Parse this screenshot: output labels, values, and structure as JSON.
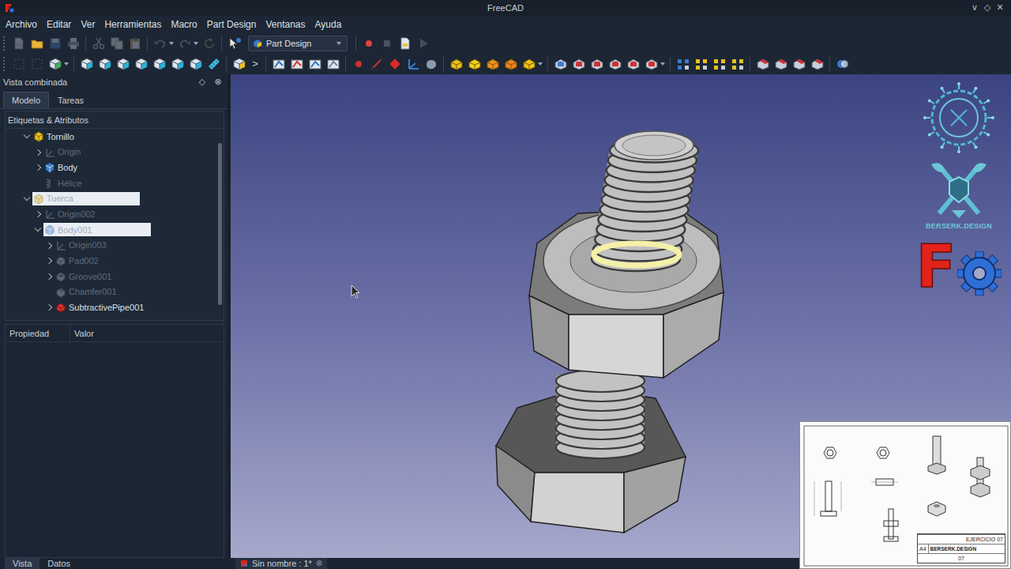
{
  "window": {
    "title": "FreeCAD",
    "controls": [
      "∨",
      "◇",
      "✕"
    ]
  },
  "menu": [
    "Archivo",
    "Editar",
    "Ver",
    "Herramientas",
    "Macro",
    "Part Design",
    "Ventanas",
    "Ayuda"
  ],
  "toolbars": [
    {
      "items": [
        {
          "kind": "button",
          "disabled": true
        },
        {
          "kind": "button",
          "disabled": false
        },
        {
          "kind": "button",
          "disabled": true
        },
        {
          "kind": "button",
          "disabled": true
        },
        {
          "kind": "separator"
        },
        {
          "kind": "button",
          "disabled": true
        },
        {
          "kind": "button",
          "disabled": true
        },
        {
          "kind": "button",
          "disabled": true
        },
        {
          "kind": "separator"
        },
        {
          "kind": "split",
          "disabled": true
        },
        {
          "kind": "split",
          "disabled": true
        },
        {
          "kind": "button",
          "disabled": true
        },
        {
          "kind": "separator"
        },
        {
          "kind": "button",
          "disabled": false
        },
        {
          "kind": "combo",
          "label": "Part Design"
        },
        {
          "kind": "separator"
        },
        {
          "kind": "button",
          "disabled": false
        },
        {
          "kind": "button",
          "disabled": true
        },
        {
          "kind": "button",
          "disabled": false
        },
        {
          "kind": "button",
          "disabled": true
        }
      ]
    },
    {
      "items": [
        {
          "kind": "button",
          "disabled": true
        },
        {
          "kind": "button",
          "disabled": true
        },
        {
          "kind": "split",
          "disabled": false
        },
        {
          "kind": "separator"
        },
        {
          "kind": "button",
          "disabled": false
        },
        {
          "kind": "button",
          "disabled": false
        },
        {
          "kind": "button",
          "disabled": false
        },
        {
          "kind": "button",
          "disabled": false
        },
        {
          "kind": "button",
          "disabled": false
        },
        {
          "kind": "button",
          "disabled": false
        },
        {
          "kind": "button",
          "disabled": false
        },
        {
          "kind": "button",
          "disabled": false
        },
        {
          "kind": "separator"
        },
        {
          "kind": "button",
          "disabled": false
        },
        {
          "kind": "chevron",
          "label": ">"
        },
        {
          "kind": "separator"
        },
        {
          "kind": "button",
          "disabled": false
        },
        {
          "kind": "button",
          "disabled": false
        },
        {
          "kind": "button",
          "disabled": false
        },
        {
          "kind": "button",
          "disabled": false
        },
        {
          "kind": "separator"
        },
        {
          "kind": "button",
          "disabled": false
        },
        {
          "kind": "button",
          "disabled": false
        },
        {
          "kind": "button",
          "disabled": false
        },
        {
          "kind": "button",
          "disabled": false
        },
        {
          "kind": "button",
          "disabled": false
        },
        {
          "kind": "separator"
        },
        {
          "kind": "button",
          "disabled": false
        },
        {
          "kind": "button",
          "disabled": false
        },
        {
          "kind": "button",
          "disabled": false
        },
        {
          "kind": "button",
          "disabled": false
        },
        {
          "kind": "split",
          "disabled": false
        },
        {
          "kind": "separator"
        },
        {
          "kind": "button",
          "disabled": false
        },
        {
          "kind": "button",
          "disabled": false
        },
        {
          "kind": "button",
          "disabled": false
        },
        {
          "kind": "button",
          "disabled": false
        },
        {
          "kind": "button",
          "disabled": false
        },
        {
          "kind": "split",
          "disabled": false
        },
        {
          "kind": "separator"
        },
        {
          "kind": "button",
          "disabled": false
        },
        {
          "kind": "button",
          "disabled": false
        },
        {
          "kind": "button",
          "disabled": false
        },
        {
          "kind": "button",
          "disabled": false
        },
        {
          "kind": "separator"
        },
        {
          "kind": "button",
          "disabled": false
        },
        {
          "kind": "button",
          "disabled": false
        },
        {
          "kind": "button",
          "disabled": false
        },
        {
          "kind": "button",
          "disabled": false
        },
        {
          "kind": "separator"
        },
        {
          "kind": "button",
          "disabled": false
        }
      ]
    }
  ],
  "combo": {
    "title": "Vista combinada",
    "controls": [
      "◇",
      "⊗"
    ],
    "tabs": [
      {
        "label": "Modelo",
        "selected": true
      },
      {
        "label": "Tareas",
        "selected": false
      }
    ],
    "tree_header": "Etiquetas & Atributos",
    "tree": [
      {
        "label": "Tornillo",
        "level": 0,
        "kind": "part",
        "expanded": true,
        "hidden": false,
        "selected": false
      },
      {
        "label": "Origin",
        "level": 1,
        "kind": "origin",
        "expanded": false,
        "hidden": true,
        "selected": false
      },
      {
        "label": "Body",
        "level": 1,
        "kind": "body",
        "expanded": false,
        "hidden": false,
        "selected": false
      },
      {
        "label": "Hélice",
        "level": 1,
        "kind": "helix",
        "hidden": true,
        "selected": false
      },
      {
        "label": "Tuerca",
        "level": 0,
        "kind": "part",
        "expanded": true,
        "hidden": true,
        "selected": true
      },
      {
        "label": "Origin002",
        "level": 1,
        "kind": "origin",
        "expanded": false,
        "hidden": true,
        "selected": false
      },
      {
        "label": "Body001",
        "level": 1,
        "kind": "body",
        "expanded": true,
        "hidden": true,
        "selected": true
      },
      {
        "label": "Origin003",
        "level": 2,
        "kind": "origin",
        "expanded": false,
        "hidden": true,
        "selected": false
      },
      {
        "label": "Pad002",
        "level": 2,
        "kind": "pad",
        "expanded": false,
        "hidden": true,
        "selected": false
      },
      {
        "label": "Groove001",
        "level": 2,
        "kind": "groove",
        "expanded": false,
        "hidden": true,
        "selected": false
      },
      {
        "label": "Chamfer001",
        "level": 2,
        "kind": "chamfer",
        "hidden": true,
        "selected": false
      },
      {
        "label": "SubtractivePipe001",
        "level": 2,
        "kind": "pipe",
        "expanded": false,
        "hidden": false,
        "selected": false
      }
    ],
    "properties": {
      "columns": [
        "Propiedad",
        "Valor"
      ]
    },
    "bottom_tabs": [
      {
        "label": "Vista",
        "selected": true
      },
      {
        "label": "Datos",
        "selected": false
      }
    ]
  },
  "viewport": {
    "brand_text": "BERSERK.DESIGN",
    "freecad_mark": "F"
  },
  "document_tabs": [
    {
      "label": "Sin nombre : 1*",
      "close": "⊗",
      "selected": true
    }
  ],
  "drawing_sheet": {
    "title": "EJERCICIO 07",
    "size": "A4",
    "number": "07",
    "brand": "BERSERK.DESIGN"
  }
}
